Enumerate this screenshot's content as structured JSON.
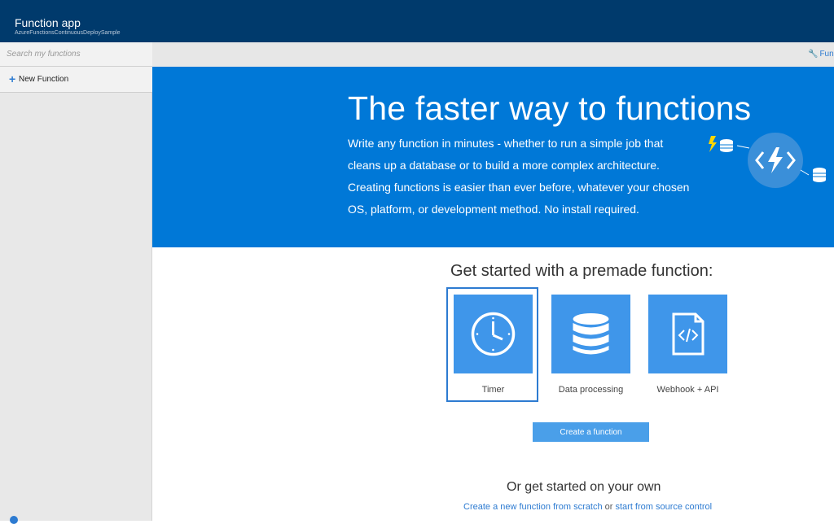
{
  "header": {
    "app_title": "Function app",
    "app_subtitle": "AzureFunctionsContinuousDeploySample"
  },
  "sidebar": {
    "search_placeholder": "Search my functions",
    "new_function_label": "New Function"
  },
  "toolbar": {
    "settings_link": "Func"
  },
  "hero": {
    "title": "The faster way to functions",
    "description": "Write any function in minutes - whether to run a simple job that cleans up a database or to build a more complex architecture. Creating functions is easier than ever before, whatever your chosen OS, platform, or development method. No install required."
  },
  "premade": {
    "title": "Get started with a premade function:",
    "tiles": [
      {
        "label": "Timer",
        "icon": "clock-icon",
        "selected": true
      },
      {
        "label": "Data processing",
        "icon": "database-icon",
        "selected": false
      },
      {
        "label": "Webhook + API",
        "icon": "code-file-icon",
        "selected": false
      }
    ],
    "create_button": "Create a function"
  },
  "own": {
    "title": "Or get started on your own",
    "link_scratch": "Create a new function from scratch",
    "separator": "or",
    "link_source": "start from source control"
  },
  "colors": {
    "topbar": "#003a6c",
    "hero": "#0078d7",
    "tile": "#3f96ea",
    "accent": "#2d7bd1"
  }
}
